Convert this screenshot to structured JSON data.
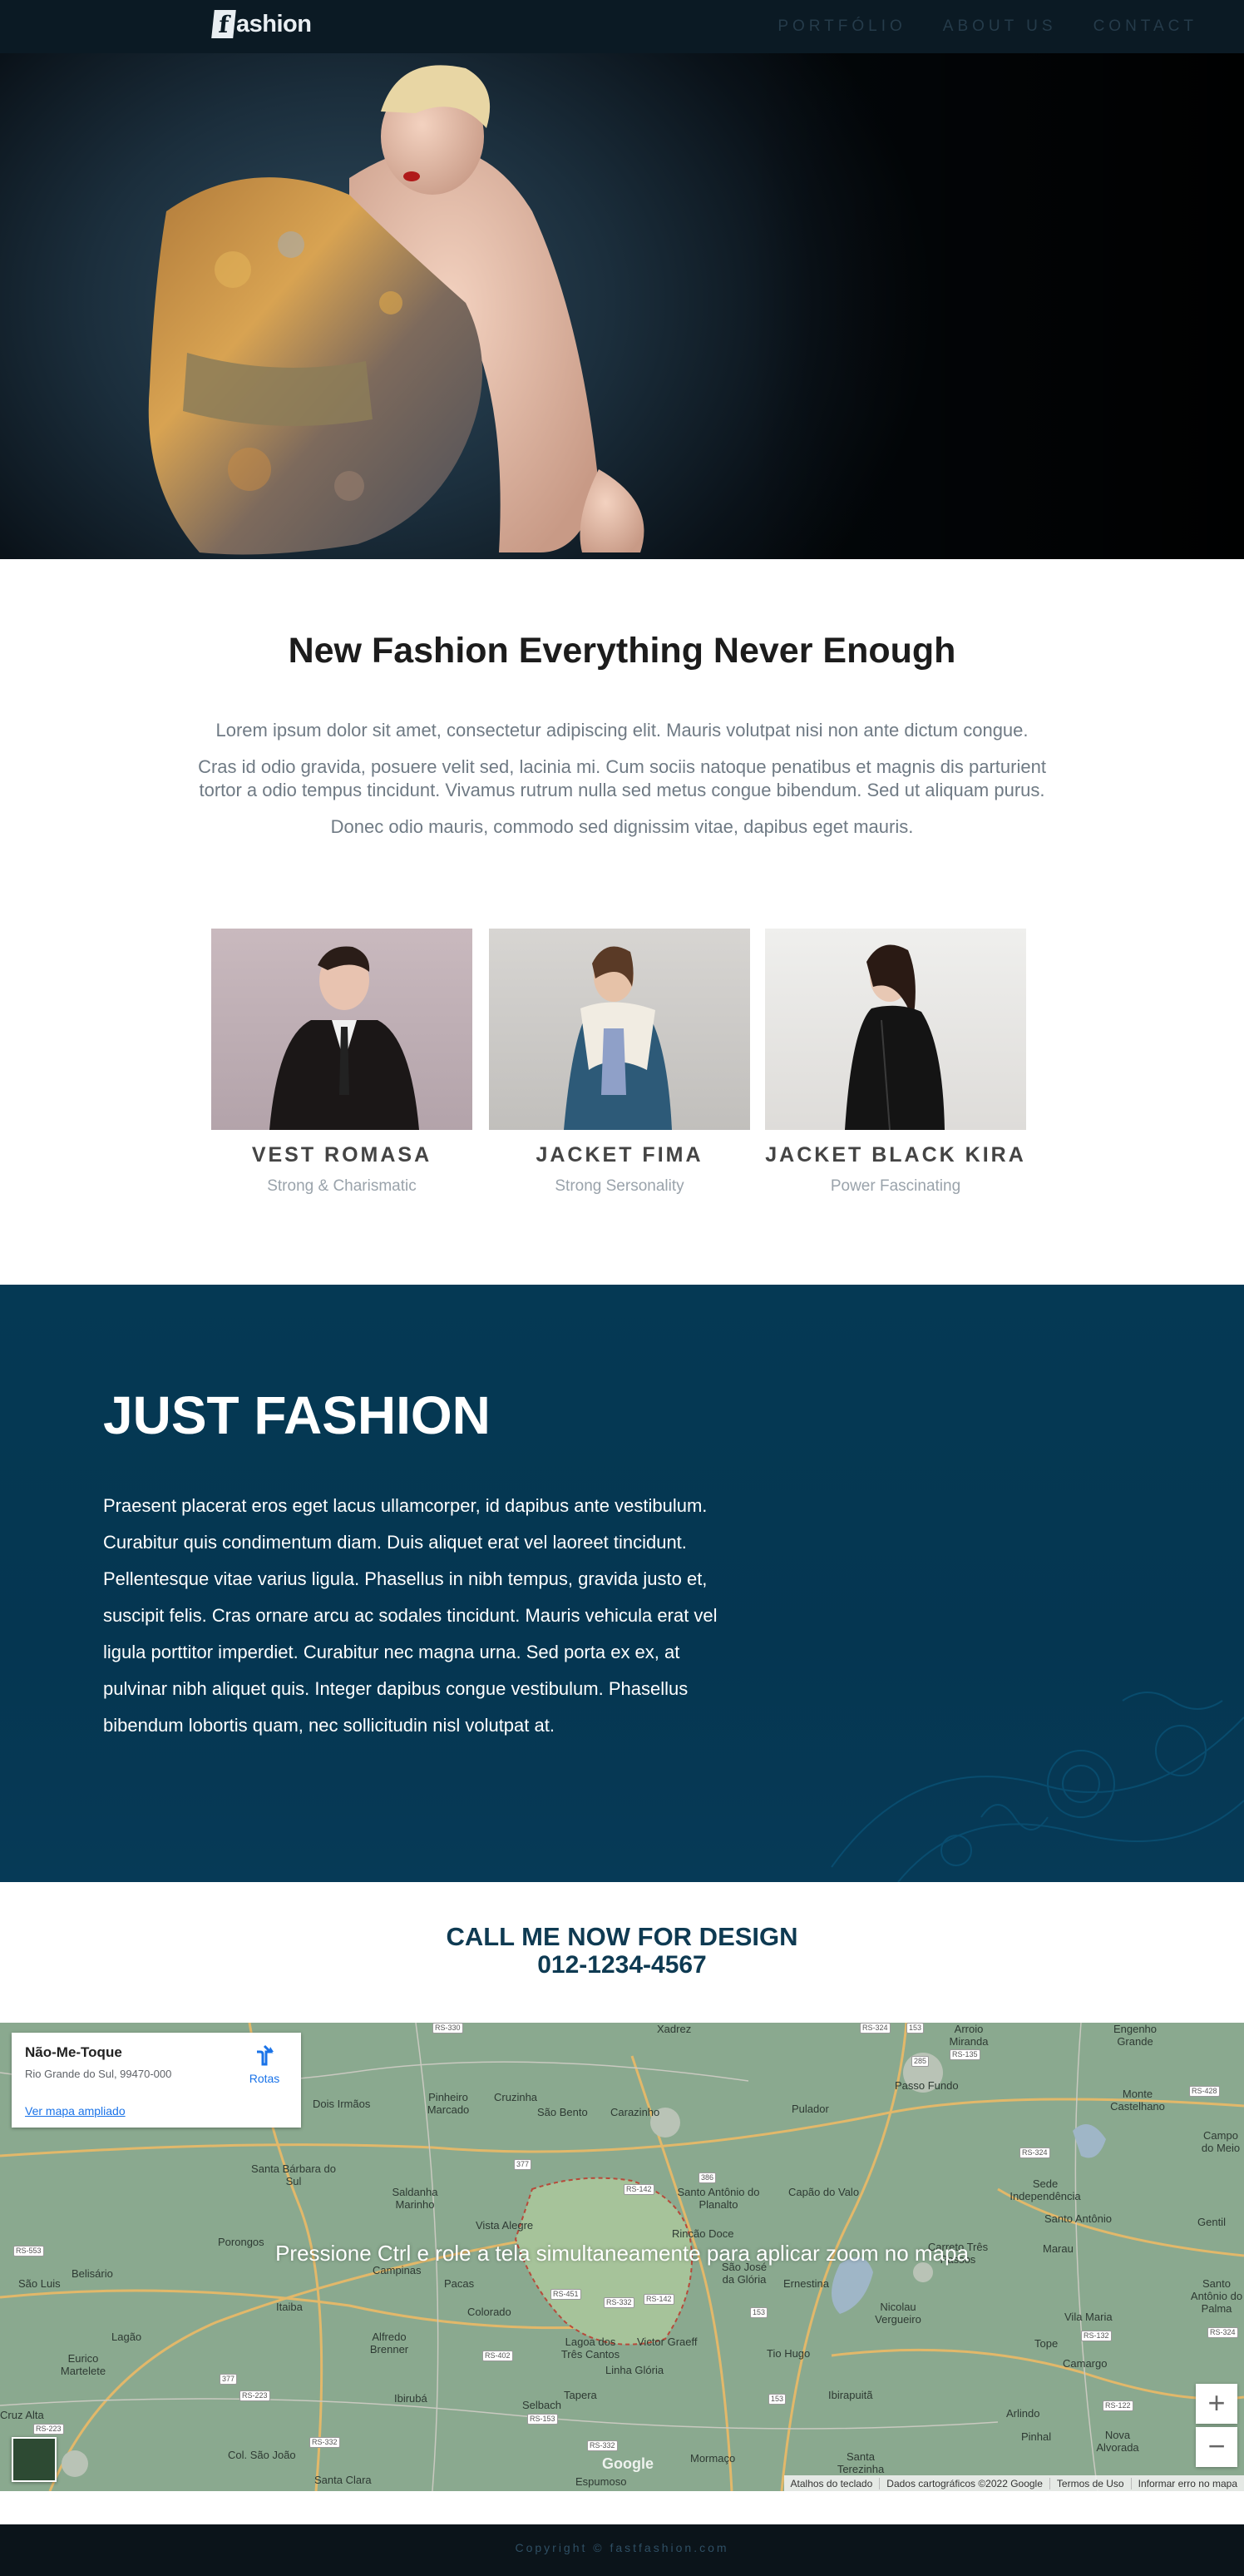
{
  "header": {
    "logo_letter": "f",
    "logo_text": "ashion",
    "nav": [
      "PORTFÓLIO",
      "ABOUT US",
      "CONTACT"
    ]
  },
  "intro": {
    "title": "New Fashion Everything Never Enough",
    "paragraphs": [
      "Lorem ipsum dolor sit amet, consectetur adipiscing elit. Mauris volutpat nisi non ante dictum congue.",
      "Cras id odio gravida, posuere velit sed, lacinia mi. Cum sociis natoque penatibus et magnis dis parturient tortor a odio tempus tincidunt. Vivamus rutrum nulla sed metus congue bibendum. Sed ut aliquam purus.",
      "Donec odio mauris, commodo sed dignissim vitae, dapibus eget mauris."
    ]
  },
  "products": [
    {
      "name": "VEST ROMASA",
      "subtitle": "Strong & Charismatic"
    },
    {
      "name": "JACKET FIMA",
      "subtitle": "Strong Sersonality"
    },
    {
      "name": "JACKET BLACK KIRA",
      "subtitle": "Power Fascinating"
    }
  ],
  "feature": {
    "title": "JUST FASHION",
    "body": "Praesent placerat eros eget lacus ullamcorper, id dapibus ante vestibulum. Curabitur quis condimentum diam. Duis aliquet erat vel laoreet tincidunt. Pellentesque vitae varius ligula. Phasellus in nibh tempus, gravida justo et, suscipit felis. Cras ornare arcu ac sodales tincidunt. Mauris vehicula erat vel ligula porttitor imperdiet. Curabitur nec magna urna. Sed porta ex ex, at pulvinar nibh aliquet quis. Integer dapibus congue vestibulum. Phasellus bibendum lobortis quam, nec sollicitudin nisl volutpat at."
  },
  "call": {
    "line1": "CALL ME NOW FOR DESIGN",
    "phone": "012-1234-4567"
  },
  "map": {
    "card_title": "Não-Me-Toque",
    "card_address": "Rio Grande do Sul, 99470-000",
    "card_link": "Ver mapa ampliado",
    "directions_label": "Rotas",
    "overlay_hint": "Pressione Ctrl e role a tela simultaneamente para aplicar zoom no mapa",
    "zoom_in": "+",
    "zoom_out": "−",
    "google_mark": "Google",
    "attribution": [
      "Atalhos do teclado",
      "Dados cartográficos ©2022 Google",
      "Termos de Uso",
      "Informar erro no mapa"
    ],
    "places": [
      "Xadrez",
      "Arroio Miranda",
      "Engenho Grande",
      "Dois Irmãos",
      "Pinheiro Marcado",
      "Cruzinha",
      "São Bento",
      "Carazinho",
      "Pulador",
      "Passo Fundo",
      "Monte Castelhano",
      "Campo do Meio",
      "Santa Bárbara do Sul",
      "Saldanha Marinho",
      "Vista Alegre",
      "Santo Antônio do Planalto",
      "Capão do Valo",
      "Sede Independência",
      "Santo Antônio",
      "Gentil",
      "Porongos",
      "Belisário",
      "São Luis",
      "Campinas",
      "Pacas",
      "Rincão Doce",
      "São José da Glória",
      "Ernestina",
      "Carreto Três Passos",
      "Marau",
      "Santo Antônio do Palma",
      "Itaiba",
      "Colorado",
      "Nicolau Vergueiro",
      "Vila Maria",
      "Lagão",
      "Alfredo Brenner",
      "Lagoa dos Três Cantos",
      "Victor Graeff",
      "Tio Hugo",
      "Tope",
      "Camargo",
      "Eurico Martelete",
      "Linha Glória",
      "Ibirubá",
      "Tapera",
      "Selbach",
      "Ibirapuitã",
      "Arlindo",
      "Pinhal",
      "Nova Alvorada",
      "Cruz Alta",
      "Col. São João",
      "Santa Clara",
      "Espumoso",
      "Mormaço",
      "Santa Terezinha"
    ],
    "roads": [
      "RS-330",
      "RS-324",
      "153",
      "RS-135",
      "285",
      "RS-428",
      "RS-324",
      "377",
      "RS-142",
      "386",
      "RS-553",
      "RS-451",
      "RS-332",
      "RS-142",
      "153",
      "RS-324",
      "RS-132",
      "RS-402",
      "377",
      "RS-223",
      "RS-223",
      "RS-153",
      "153",
      "RS-122",
      "RS-332",
      "RS-332"
    ]
  },
  "footer": {
    "copyright": "Copyright © fastfashion.com"
  },
  "colors": {
    "band": "#053954",
    "heading_dark": "#1c1c1c",
    "call_color": "#0e3a52",
    "footer_bg": "#0b141a"
  }
}
